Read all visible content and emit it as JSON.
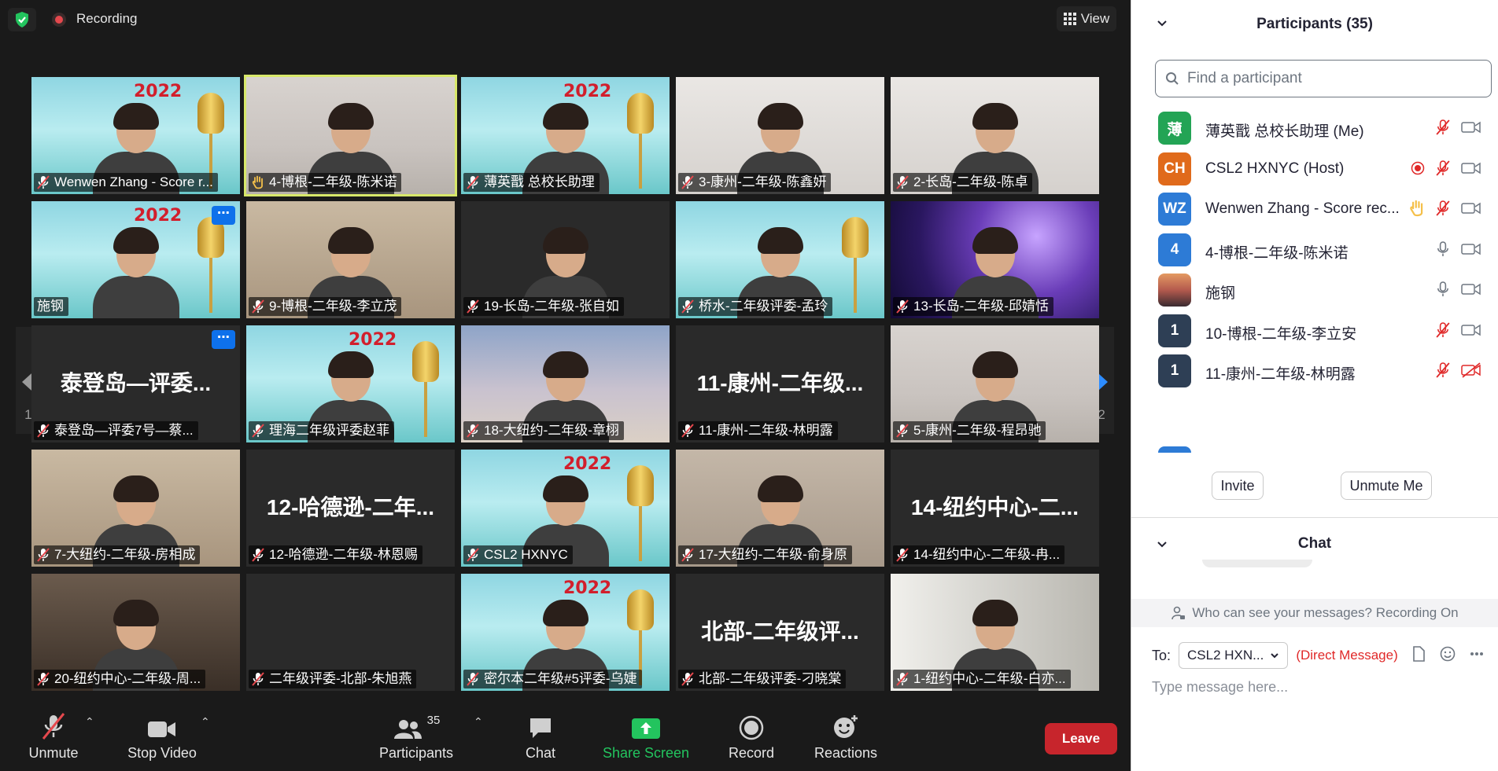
{
  "topbar": {
    "recording_label": "Recording",
    "view_label": "View"
  },
  "tiles": [
    {
      "name": "Wenwen Zhang - Score r...",
      "icon": "muted",
      "bg": "poster",
      "poster": "2022"
    },
    {
      "name": "4-博根-二年级-陈米诺",
      "icon": "raised-hand",
      "bg": "room1",
      "active": true
    },
    {
      "name": "薄英戬 总校长助理",
      "icon": "muted",
      "bg": "poster",
      "poster": "2022"
    },
    {
      "name": "3-康州-二年级-陈鑫妍",
      "icon": "muted",
      "bg": "room3"
    },
    {
      "name": "2-长岛-二年级-陈卓",
      "icon": "muted",
      "bg": "room3"
    },
    {
      "name": "施钢",
      "icon": "none",
      "bg": "poster",
      "poster": "2022",
      "more": true
    },
    {
      "name": "9-博根-二年级-李立茂",
      "icon": "muted",
      "bg": "warm"
    },
    {
      "name": "19-长岛-二年级-张自如",
      "icon": "muted",
      "bg": "dark"
    },
    {
      "name": "桥水-二年级评委-孟玲",
      "icon": "muted",
      "bg": "poster"
    },
    {
      "name": "13-长岛-二年级-邱婧恬",
      "icon": "muted",
      "bg": "purple"
    },
    {
      "name": "泰登岛—评委7号—蔡...",
      "icon": "muted",
      "bg": "dark",
      "big": "泰登岛—评委...",
      "more": true
    },
    {
      "name": "理海二年级评委赵菲",
      "icon": "muted",
      "bg": "poster",
      "poster": "2022"
    },
    {
      "name": "18-大纽约-二年级-章栩",
      "icon": "muted",
      "bg": "blue-room"
    },
    {
      "name": "11-康州-二年级-林明露",
      "icon": "muted",
      "bg": "dark",
      "big": "11-康州-二年级..."
    },
    {
      "name": "5-康州-二年级-程昂驰",
      "icon": "muted",
      "bg": "room1"
    },
    {
      "name": "7-大纽约-二年级-房相成",
      "icon": "muted",
      "bg": "warm"
    },
    {
      "name": "12-哈德逊-二年级-林恩赐",
      "icon": "muted",
      "bg": "dark",
      "big": "12-哈德逊-二年..."
    },
    {
      "name": "CSL2 HXNYC",
      "icon": "muted",
      "bg": "poster",
      "poster": "2022"
    },
    {
      "name": "17-大纽约-二年级-俞身原",
      "icon": "muted",
      "bg": "room2"
    },
    {
      "name": "14-纽约中心-二年级-冉...",
      "icon": "muted",
      "bg": "dark",
      "big": "14-纽约中心-二..."
    },
    {
      "name": "20-纽约中心-二年级-周...",
      "icon": "muted",
      "bg": "office"
    },
    {
      "name": "二年级评委-北部-朱旭燕",
      "icon": "muted",
      "bg": "dark"
    },
    {
      "name": "密尔本二年级#5评委-乌婕",
      "icon": "muted",
      "bg": "poster",
      "poster": "2022"
    },
    {
      "name": "北部-二年级评委-刁晓棠",
      "icon": "muted",
      "bg": "dark",
      "big": "北部-二年级评..."
    },
    {
      "name": "1-纽约中心-二年级-白亦...",
      "icon": "muted",
      "bg": "window"
    }
  ],
  "pager": {
    "left_label": "1/2",
    "right_label": "1/2"
  },
  "toolbar": {
    "unmute_label": "Unmute",
    "stop_video_label": "Stop Video",
    "participants_label": "Participants",
    "participants_count": "35",
    "chat_label": "Chat",
    "share_label": "Share Screen",
    "record_label": "Record",
    "reactions_label": "Reactions",
    "leave_label": "Leave"
  },
  "panel": {
    "participants_title": "Participants (35)",
    "search_placeholder": "Find a participant",
    "participants": [
      {
        "initials": "薄",
        "color": "#23a455",
        "name": "薄英戬 总校长助理 (Me)",
        "mic": "muted",
        "video": "on"
      },
      {
        "initials": "CH",
        "color": "#e06a1b",
        "name": "CSL2 HXNYC (Host)",
        "mic": "muted",
        "video": "on",
        "recording": true
      },
      {
        "initials": "WZ",
        "color": "#2d7bd6",
        "name": "Wenwen Zhang - Score rec...",
        "mic": "muted",
        "video": "on",
        "hand": true
      },
      {
        "initials": "4",
        "color": "#2d7bd6",
        "name": "4-博根-二年级-陈米诺",
        "mic": "on",
        "video": "on"
      },
      {
        "initials": "",
        "color": "#b46a5a",
        "name": "施钢",
        "mic": "on",
        "video": "on",
        "photo": true
      },
      {
        "initials": "1",
        "color": "#2e3f55",
        "name": "10-博根-二年级-李立安",
        "mic": "muted",
        "video": "on"
      },
      {
        "initials": "1",
        "color": "#2e3f55",
        "name": "11-康州-二年级-林明露",
        "mic": "muted",
        "video": "off"
      }
    ],
    "invite_label": "Invite",
    "unmute_me_label": "Unmute Me",
    "chat_title": "Chat",
    "chat_notice": "Who can see your messages? Recording On",
    "to_label": "To:",
    "to_value": "CSL2 HXN...",
    "direct_message_label": "(Direct Message)",
    "message_placeholder": "Type message here..."
  }
}
